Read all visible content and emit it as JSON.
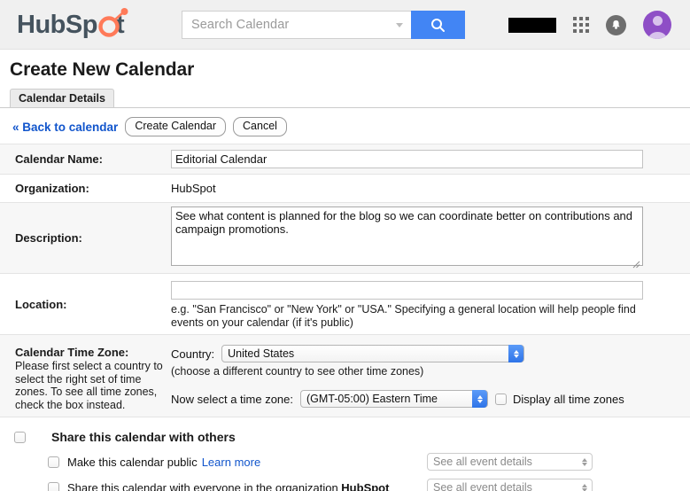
{
  "header": {
    "logo_text": "HubSpot",
    "search": {
      "placeholder": "Search Calendar",
      "value": ""
    },
    "icons": {
      "search": "search-icon",
      "dropdown": "chevron-down-icon",
      "apps": "apps-grid-icon",
      "notifications": "bell-icon",
      "avatar": "user-avatar-icon",
      "redaction": "redacted-label"
    }
  },
  "page": {
    "title": "Create New Calendar",
    "tabs": [
      {
        "label": "Calendar Details",
        "active": true
      }
    ],
    "actions": {
      "back_link": "« Back to calendar",
      "create_button": "Create Calendar",
      "cancel_button": "Cancel"
    }
  },
  "form": {
    "calendar_name": {
      "label": "Calendar Name:",
      "value": "Editorial Calendar",
      "placeholder": ""
    },
    "organization": {
      "label": "Organization:",
      "value": "HubSpot"
    },
    "description": {
      "label": "Description:",
      "value": "See what content is planned for the blog so we can coordinate better on contributions and campaign promotions.",
      "placeholder": ""
    },
    "location": {
      "label": "Location:",
      "value": "",
      "placeholder": "",
      "help": "e.g. \"San Francisco\" or \"New York\" or \"USA.\" Specifying a general location will help people find events on your calendar (if it's public)"
    },
    "timezone": {
      "label": "Calendar Time Zone:",
      "description": "Please first select a country to select the right set of time zones. To see all time zones, check the box instead.",
      "country_label": "Country:",
      "country_value": "United States",
      "country_hint": "(choose a different country to see other time zones)",
      "zone_label": "Now select a time zone:",
      "zone_value": "(GMT-05:00) Eastern Time",
      "display_all_label": "Display all time zones",
      "display_all_checked": false
    }
  },
  "share": {
    "heading": "Share this calendar with others",
    "heading_checked": false,
    "rows": [
      {
        "label": "Make this calendar public",
        "link": "Learn more",
        "checked": false,
        "permission": "See all event details",
        "disabled": true
      },
      {
        "label_prefix": "Share this calendar with everyone in the organization ",
        "label_org": "HubSpot",
        "checked": false,
        "permission": "See all event details",
        "disabled": true
      }
    ]
  },
  "colors": {
    "brand_orange": "#ff7a59",
    "brand_dark": "#45535e",
    "accent_blue": "#4285f4",
    "link_blue": "#1155cc",
    "row_shaded": "#f7f7f7",
    "avatar_purple": "#8e4ec6"
  }
}
